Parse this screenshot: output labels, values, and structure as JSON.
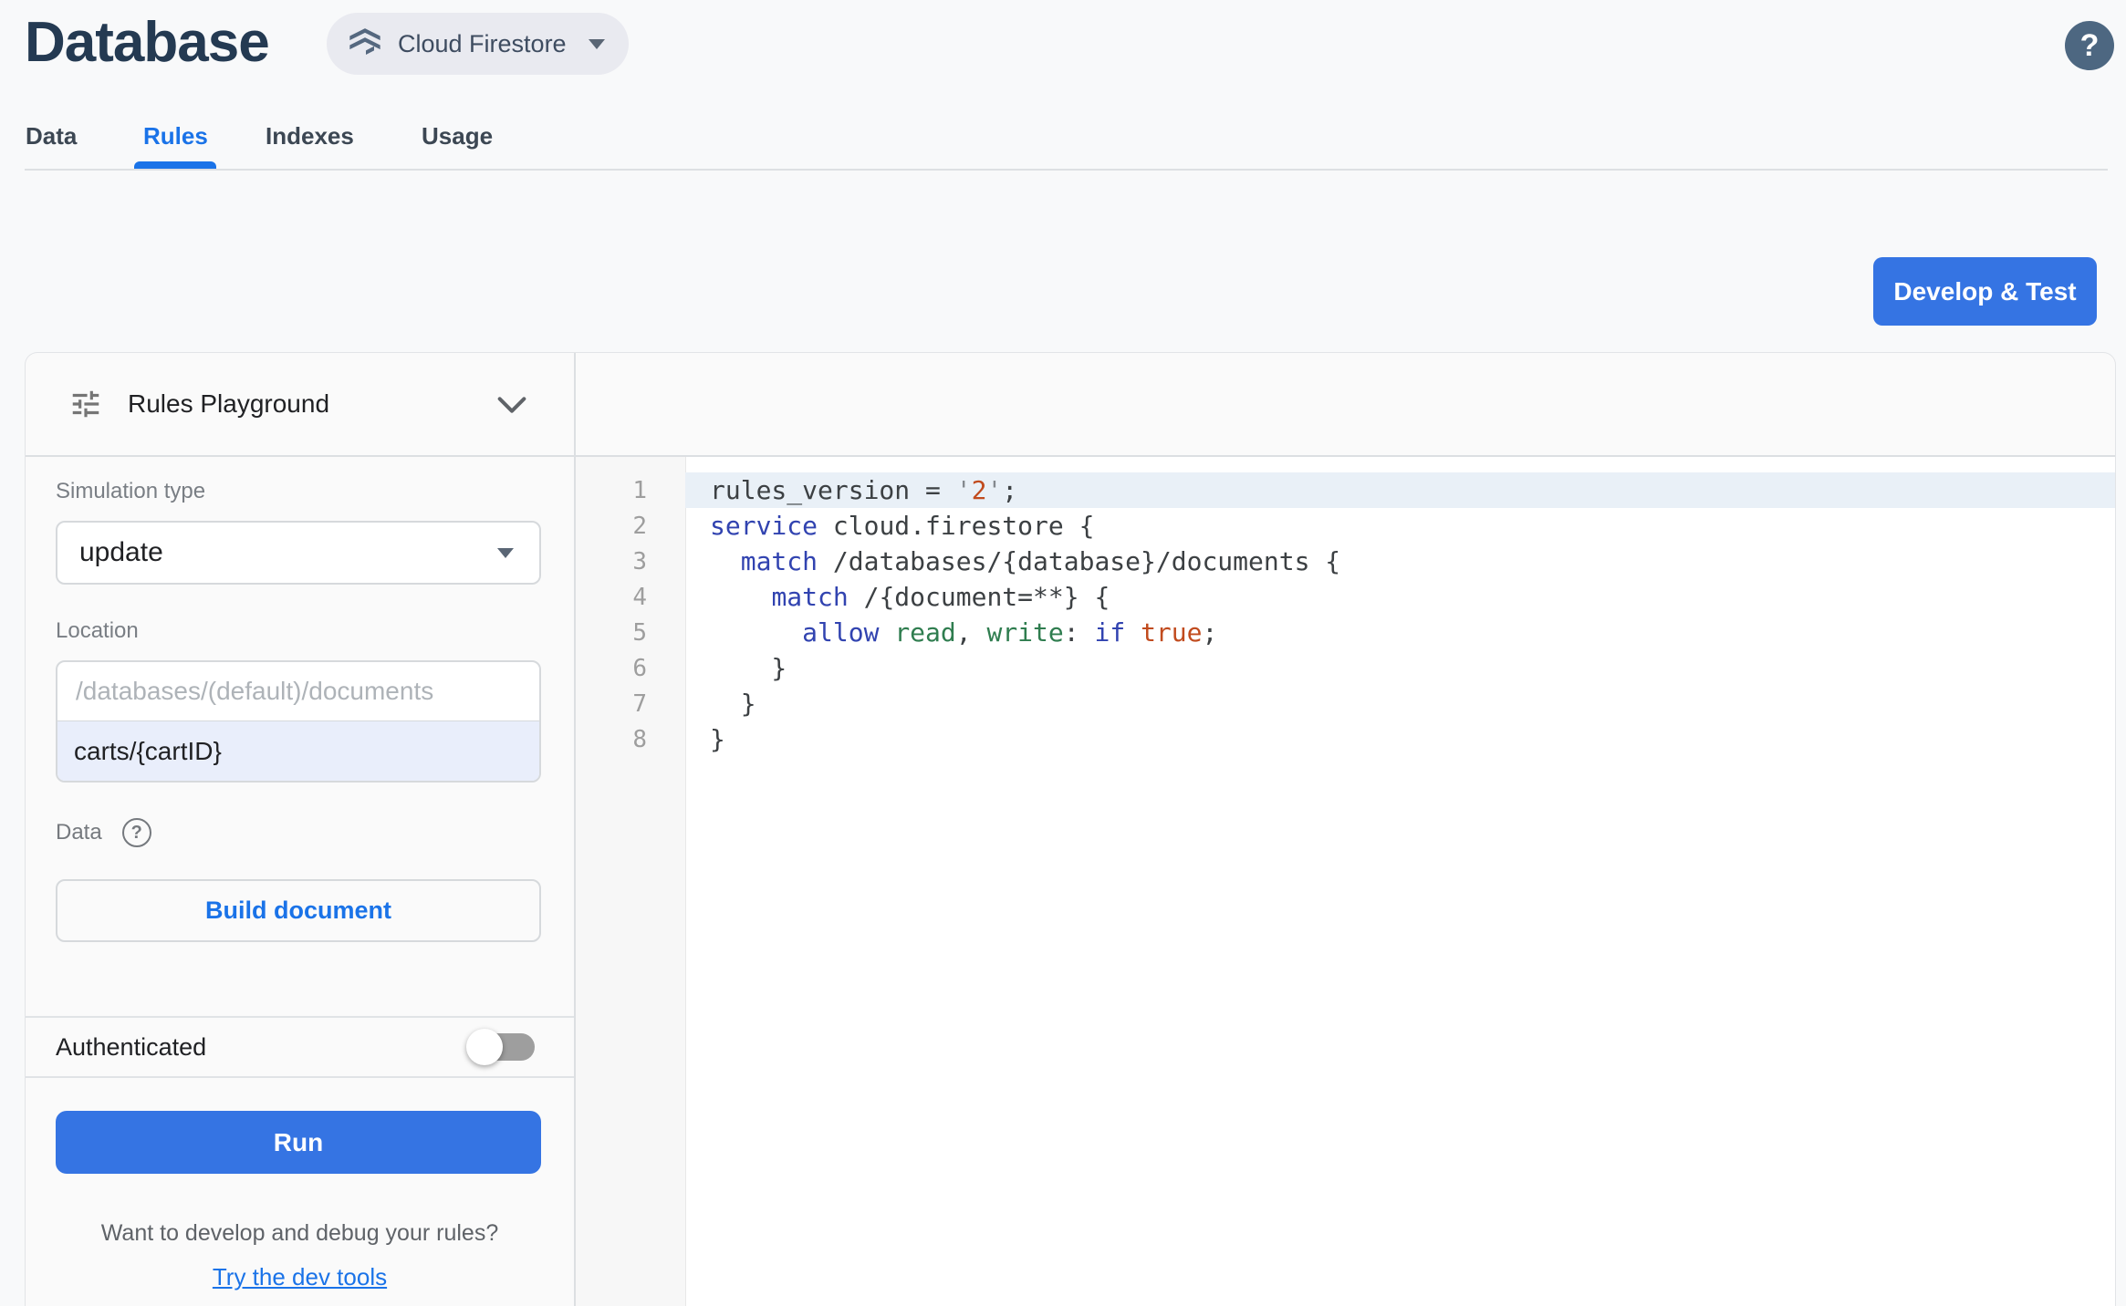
{
  "header": {
    "title": "Database",
    "product_switcher": {
      "label": "Cloud Firestore"
    },
    "help_glyph": "?"
  },
  "tabs": [
    {
      "label": "Data",
      "active": false
    },
    {
      "label": "Rules",
      "active": true
    },
    {
      "label": "Indexes",
      "active": false
    },
    {
      "label": "Usage",
      "active": false
    }
  ],
  "actions": {
    "develop_test_label": "Develop & Test"
  },
  "playground": {
    "title": "Rules Playground",
    "simulation_type": {
      "label": "Simulation type",
      "value": "update"
    },
    "location": {
      "label": "Location",
      "base_path": "/databases/(default)/documents",
      "value": "carts/{cartID}"
    },
    "data_section": {
      "label": "Data",
      "help_glyph": "?",
      "build_button_label": "Build document"
    },
    "auth": {
      "label": "Authenticated",
      "enabled": false
    },
    "run_label": "Run",
    "footer": {
      "question": "Want to develop and debug your rules?",
      "link_label": "Try the dev tools"
    }
  },
  "editor": {
    "active_line": 1,
    "lines": [
      {
        "number": 1,
        "tokens": [
          {
            "t": "rules_version = ",
            "c": "p"
          },
          {
            "t": "'",
            "c": "q"
          },
          {
            "t": "2",
            "c": "r"
          },
          {
            "t": "'",
            "c": "q"
          },
          {
            "t": ";",
            "c": "p"
          }
        ]
      },
      {
        "number": 2,
        "tokens": [
          {
            "t": "service",
            "c": "k"
          },
          {
            "t": " cloud.firestore {",
            "c": "p"
          }
        ]
      },
      {
        "number": 3,
        "tokens": [
          {
            "t": "  ",
            "c": "p"
          },
          {
            "t": "match",
            "c": "k"
          },
          {
            "t": " /databases/{database}/documents {",
            "c": "p"
          }
        ]
      },
      {
        "number": 4,
        "tokens": [
          {
            "t": "    ",
            "c": "p"
          },
          {
            "t": "match",
            "c": "k"
          },
          {
            "t": " /{document=**} {",
            "c": "p"
          }
        ]
      },
      {
        "number": 5,
        "tokens": [
          {
            "t": "      ",
            "c": "p"
          },
          {
            "t": "allow",
            "c": "k"
          },
          {
            "t": " ",
            "c": "p"
          },
          {
            "t": "read",
            "c": "g"
          },
          {
            "t": ", ",
            "c": "p"
          },
          {
            "t": "write",
            "c": "g"
          },
          {
            "t": ": ",
            "c": "p"
          },
          {
            "t": "if",
            "c": "k"
          },
          {
            "t": " ",
            "c": "p"
          },
          {
            "t": "true",
            "c": "r"
          },
          {
            "t": ";",
            "c": "p"
          }
        ]
      },
      {
        "number": 6,
        "tokens": [
          {
            "t": "    }",
            "c": "p"
          }
        ]
      },
      {
        "number": 7,
        "tokens": [
          {
            "t": "  }",
            "c": "p"
          }
        ]
      },
      {
        "number": 8,
        "tokens": [
          {
            "t": "}",
            "c": "p"
          }
        ]
      }
    ]
  },
  "colors": {
    "accent_blue": "#3574e3",
    "link_blue": "#1a73e8",
    "title_navy": "#243a52",
    "active_line_bg": "#e9f0f7",
    "location_value_bg": "#e9eefb",
    "keyword": "#3143b0",
    "permission_green": "#2f7d4f",
    "constant_red": "#c14b1e"
  }
}
